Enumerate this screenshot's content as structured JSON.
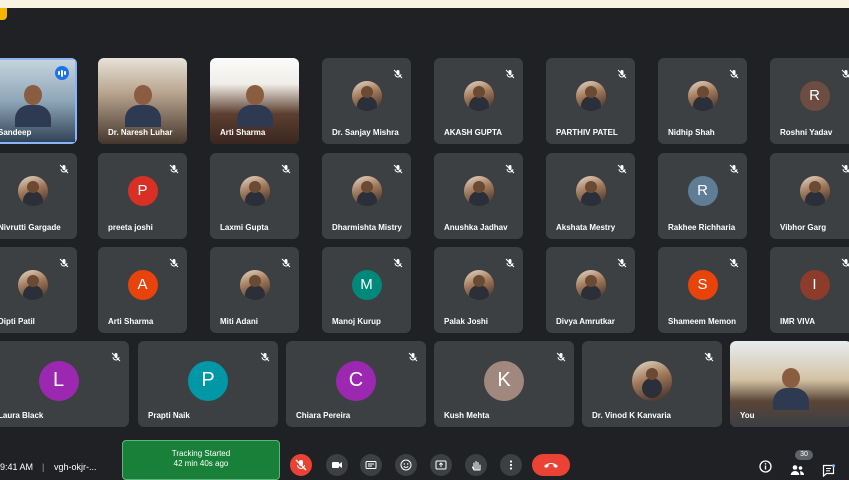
{
  "colors": {
    "meet_bg": "#202124",
    "tile_bg": "#3c4043",
    "tracking_bg": "#188038",
    "hangup": "#ea4335",
    "speaking": "#1a73e8"
  },
  "tiles": [
    {
      "name": "Sandeep",
      "kind": "video",
      "style": "v1",
      "speaking": true
    },
    {
      "name": "Dr. Naresh Luhar",
      "kind": "video",
      "style": "v2"
    },
    {
      "name": "Arti Sharma",
      "kind": "video",
      "style": "v3"
    },
    {
      "name": "Dr. Sanjay Mishra",
      "kind": "photo"
    },
    {
      "name": "AKASH GUPTA",
      "kind": "photo"
    },
    {
      "name": "PARTHIV PATEL",
      "kind": "photo"
    },
    {
      "name": "Nidhip Shah",
      "kind": "photo"
    },
    {
      "name": "Roshni Yadav",
      "kind": "letter",
      "letter": "R",
      "color": "#6d4c41"
    },
    {
      "name": "Nivrutti Gargade",
      "kind": "photo"
    },
    {
      "name": "preeta joshi",
      "kind": "letter",
      "letter": "P",
      "color": "#d93025"
    },
    {
      "name": "Laxmi Gupta",
      "kind": "photo"
    },
    {
      "name": "Dharmishta Mistry",
      "kind": "photo"
    },
    {
      "name": "Anushka Jadhav",
      "kind": "photo"
    },
    {
      "name": "Akshata Mestry",
      "kind": "photo"
    },
    {
      "name": "Rakhee Richharia",
      "kind": "letter",
      "letter": "R",
      "color": "#5f7d95"
    },
    {
      "name": "Vibhor Garg",
      "kind": "photo"
    },
    {
      "name": "Dipti Patil",
      "kind": "photo"
    },
    {
      "name": "Arti Sharma",
      "kind": "letter",
      "letter": "A",
      "color": "#e8430a"
    },
    {
      "name": "Miti Adani",
      "kind": "photo"
    },
    {
      "name": "Manoj Kurup",
      "kind": "letter",
      "letter": "M",
      "color": "#00897b"
    },
    {
      "name": "Palak Joshi",
      "kind": "photo"
    },
    {
      "name": "Divya Amrutkar",
      "kind": "photo"
    },
    {
      "name": "Shameem Memon",
      "kind": "letter",
      "letter": "S",
      "color": "#e8430a"
    },
    {
      "name": "IMR VIVA",
      "kind": "letter",
      "letter": "I",
      "color": "#8d3b2a"
    },
    {
      "name": "Laura Black",
      "kind": "letter",
      "letter": "L",
      "color": "#9c27b0"
    },
    {
      "name": "Prapti Naik",
      "kind": "letter",
      "letter": "P",
      "color": "#0097a7"
    },
    {
      "name": "Chiara Pereira",
      "kind": "letter",
      "letter": "C",
      "color": "#9c27b0"
    },
    {
      "name": "Kush Mehta",
      "kind": "letter",
      "letter": "K",
      "color": "#a1887f"
    },
    {
      "name": "Dr. Vinod K Kanvaria",
      "kind": "photo"
    },
    {
      "name": "You",
      "kind": "video",
      "style": "you"
    }
  ],
  "bottom": {
    "time": "9:41 AM",
    "separator": "|",
    "meeting_code": "vgh-okjr-...",
    "tracking_line1": "Tracking Started",
    "tracking_line2": "42 min 40s ago",
    "participant_count": "30"
  },
  "icons": {
    "mic_off": "mic-off-icon",
    "camera": "camera-icon",
    "captions": "captions-icon",
    "emoji": "emoji-icon",
    "present": "present-icon",
    "raise_hand": "raise-hand-icon",
    "more": "more-options-icon",
    "hangup": "hang-up-icon",
    "info": "info-icon",
    "people": "people-icon",
    "chat": "chat-icon"
  }
}
